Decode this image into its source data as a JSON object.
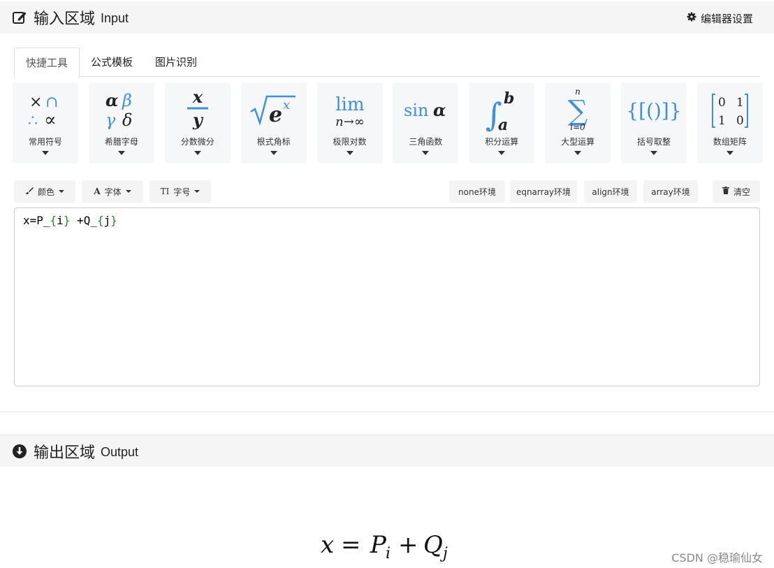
{
  "input_header": {
    "title": "输入区域",
    "subtitle": "Input",
    "icon": "edit-icon"
  },
  "settings": {
    "label": "编辑器设置",
    "icon": "gear-icon"
  },
  "tabs": [
    {
      "label": "快捷工具",
      "active": true
    },
    {
      "label": "公式模板",
      "active": false
    },
    {
      "label": "图片识别",
      "active": false
    }
  ],
  "tools": [
    {
      "label": "常用符号",
      "icon": "common-symbols-icon"
    },
    {
      "label": "希腊字母",
      "icon": "greek-letters-icon"
    },
    {
      "label": "分数微分",
      "icon": "fraction-icon"
    },
    {
      "label": "根式角标",
      "icon": "radical-icon"
    },
    {
      "label": "极限对数",
      "icon": "limit-icon"
    },
    {
      "label": "三角函数",
      "icon": "trig-icon"
    },
    {
      "label": "积分运算",
      "icon": "integral-icon"
    },
    {
      "label": "大型运算",
      "icon": "summation-icon"
    },
    {
      "label": "括号取整",
      "icon": "brackets-icon"
    },
    {
      "label": "数组矩阵",
      "icon": "matrix-icon"
    }
  ],
  "toolbar": {
    "color": "颜色",
    "font": "字体",
    "size": "字号",
    "env_none": "none环境",
    "env_eqnarray": "eqnarray环境",
    "env_align": "align环境",
    "env_array": "array环境",
    "clear": "清空"
  },
  "editor": {
    "p1": "x=P_",
    "b1o": "{",
    "v1": "i",
    "b1c": "}",
    "p2": " +Q_",
    "b2o": "{",
    "v2": "j",
    "b2c": "}"
  },
  "output_header": {
    "title": "输出区域",
    "subtitle": "Output",
    "icon": "arrow-down-circle-icon"
  },
  "output": {
    "x": "x",
    "eq": "=",
    "P": "P",
    "i": "i",
    "plus": "+",
    "Q": "Q",
    "j": "j"
  },
  "watermark": "CSDN @稳瑜仙女",
  "colors": {
    "accent_blue": "#3d8fe0",
    "brace_green": "#2e7d32"
  }
}
